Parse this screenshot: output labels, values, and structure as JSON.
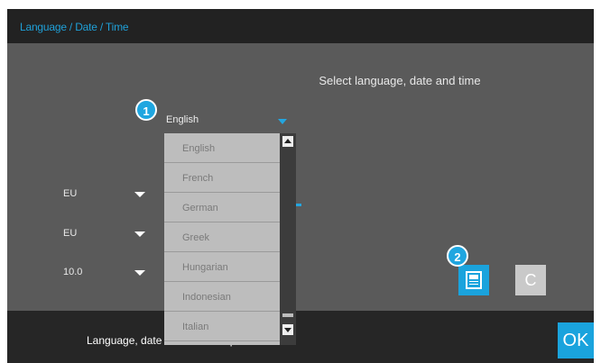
{
  "title": "Language / Date / Time",
  "heading": "Select language, date and time",
  "language": {
    "selected": "English",
    "options": [
      "English",
      "French",
      "German",
      "Greek",
      "Hungarian",
      "Indonesian",
      "Italian"
    ]
  },
  "selectors": {
    "date_format": "EU",
    "time_format": "EU",
    "time_value": "10.0"
  },
  "buttons": {
    "cancel_label": "C",
    "ok_label": "OK"
  },
  "status_text": "Language, date and time setup",
  "badges": [
    "1",
    "2"
  ],
  "colors": {
    "accent": "#1aa3dd",
    "titlebar": "#222222",
    "panel": "#5a5a5a"
  }
}
